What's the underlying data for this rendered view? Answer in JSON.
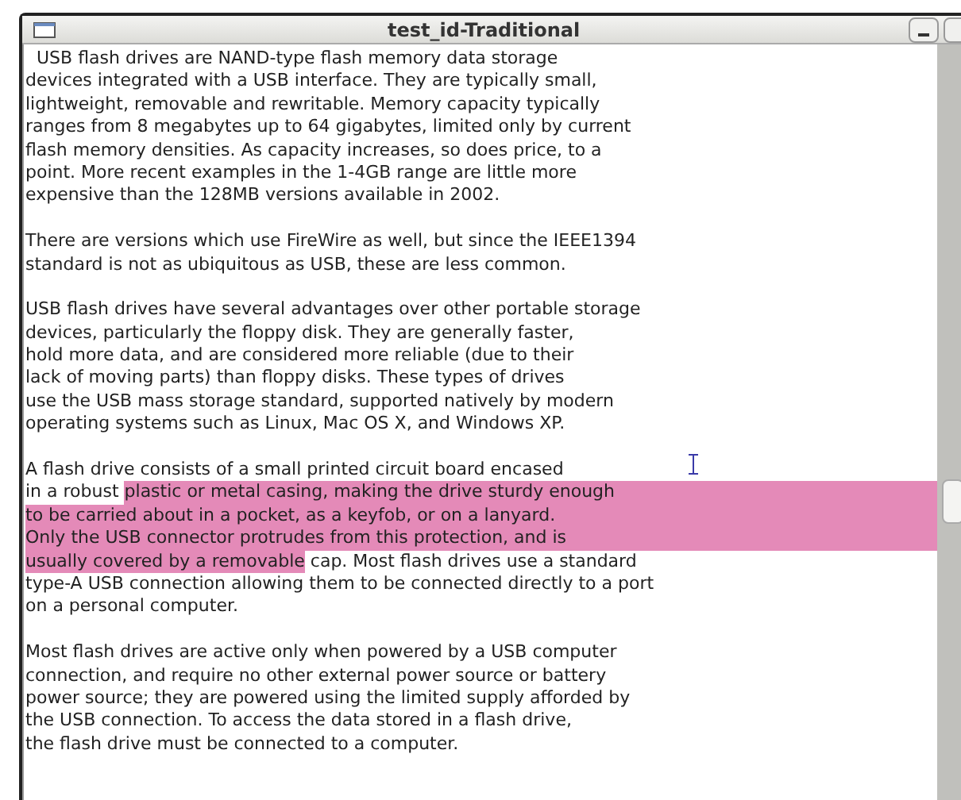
{
  "window": {
    "title": "test_id-Traditional"
  },
  "paragraphs": [
    {
      "lines": [
        [
          {
            "text": "  USB flash drives are NAND-type flash memory data storage",
            "selected": false
          }
        ],
        [
          {
            "text": "devices integrated with a USB interface. They are typically small,",
            "selected": false
          }
        ],
        [
          {
            "text": "lightweight, removable and rewritable. Memory capacity typically",
            "selected": false
          }
        ],
        [
          {
            "text": "ranges from 8 megabytes up to 64 gigabytes, limited only by current",
            "selected": false
          }
        ],
        [
          {
            "text": "flash memory densities. As capacity increases, so does price, to a",
            "selected": false
          }
        ],
        [
          {
            "text": "point. More recent examples in the 1-4GB range are little more",
            "selected": false
          }
        ],
        [
          {
            "text": "expensive than the 128MB versions available in 2002.",
            "selected": false
          }
        ]
      ]
    },
    {
      "lines": [
        [
          {
            "text": "There are versions which use FireWire as well, but since the IEEE1394",
            "selected": false
          }
        ],
        [
          {
            "text": "standard is not as ubiquitous as USB, these are less common.",
            "selected": false
          }
        ]
      ]
    },
    {
      "lines": [
        [
          {
            "text": "USB flash drives have several advantages over other portable storage",
            "selected": false
          }
        ],
        [
          {
            "text": "devices, particularly the floppy disk. They are generally faster,",
            "selected": false
          }
        ],
        [
          {
            "text": "hold more data, and are considered more reliable (due to their",
            "selected": false
          }
        ],
        [
          {
            "text": "lack of moving parts) than floppy disks. These types of drives",
            "selected": false
          }
        ],
        [
          {
            "text": "use the USB mass storage standard, supported natively by modern",
            "selected": false
          }
        ],
        [
          {
            "text": "operating systems such as Linux, Mac OS X, and Windows XP.",
            "selected": false
          }
        ]
      ]
    },
    {
      "lines": [
        [
          {
            "text": "A flash drive consists of a small printed circuit board encased",
            "selected": false
          }
        ],
        [
          {
            "text": "in a robust ",
            "selected": false
          },
          {
            "text": "plastic or metal casing, making the drive sturdy enough",
            "selected": true
          }
        ],
        [
          {
            "text": "to be carried about in a pocket, as a keyfob, or on a lanyard.",
            "selected": true
          }
        ],
        [
          {
            "text": "Only the USB connector protrudes from this protection, and is",
            "selected": true
          }
        ],
        [
          {
            "text": "usually covered by a removable",
            "selected": true
          },
          {
            "text": " cap. Most flash drives use a standard",
            "selected": false
          }
        ],
        [
          {
            "text": "type-A USB connection allowing them to be connected directly to a port",
            "selected": false
          }
        ],
        [
          {
            "text": "on a personal computer.",
            "selected": false
          }
        ]
      ]
    },
    {
      "lines": [
        [
          {
            "text": "Most flash drives are active only when powered by a USB computer",
            "selected": false
          }
        ],
        [
          {
            "text": "connection, and require no other external power source or battery",
            "selected": false
          }
        ],
        [
          {
            "text": "power source; they are powered using the limited supply afforded by",
            "selected": false
          }
        ],
        [
          {
            "text": "the USB connection. To access the data stored in a flash drive,",
            "selected": false
          }
        ],
        [
          {
            "text": "the flash drive must be connected to a computer.",
            "selected": false
          }
        ]
      ]
    }
  ]
}
